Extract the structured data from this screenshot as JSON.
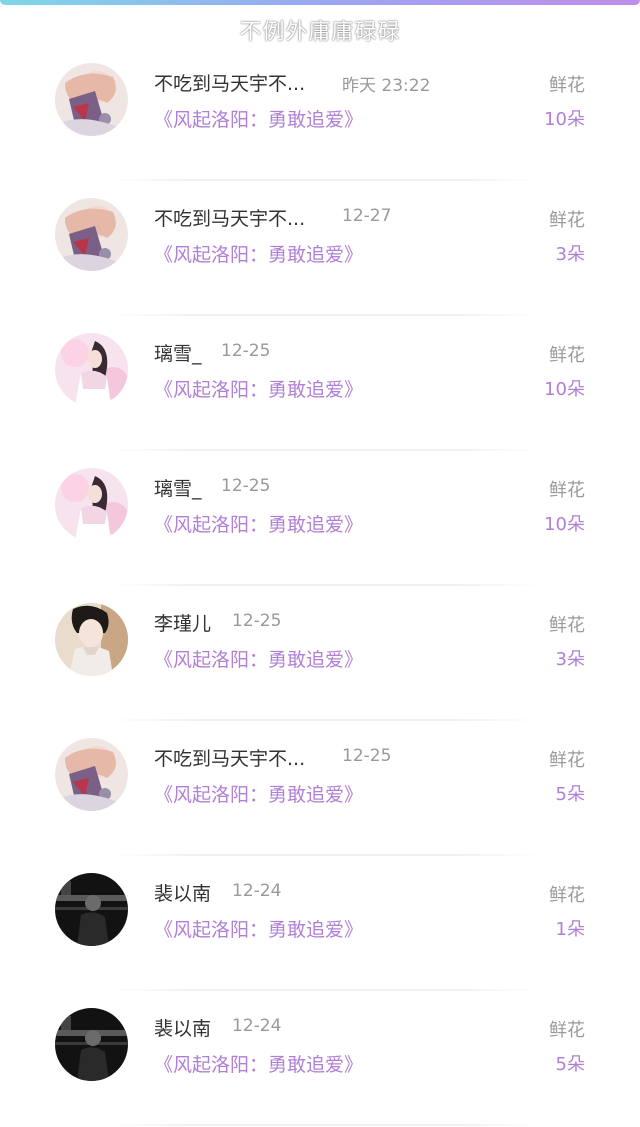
{
  "header": {
    "watermark": "不例外庸庸碌碌"
  },
  "gift_records": [
    {
      "user": "不吃到马天宇不...",
      "time": "昨天 23:22",
      "book": "《风起洛阳：勇敢追爱》",
      "gift_type": "鲜花",
      "count": "10朵",
      "avatar": "anime-girl-avatar"
    },
    {
      "user": "不吃到马天宇不...",
      "time": "12-27",
      "book": "《风起洛阳：勇敢追爱》",
      "gift_type": "鲜花",
      "count": "3朵",
      "avatar": "anime-girl-avatar"
    },
    {
      "user": "璃雪_",
      "time": "12-25",
      "book": "《风起洛阳：勇敢追爱》",
      "gift_type": "鲜花",
      "count": "10朵",
      "avatar": "pink-girl-avatar"
    },
    {
      "user": "璃雪_",
      "time": "12-25",
      "book": "《风起洛阳：勇敢追爱》",
      "gift_type": "鲜花",
      "count": "10朵",
      "avatar": "pink-girl-avatar"
    },
    {
      "user": "李瑾儿",
      "time": "12-25",
      "book": "《风起洛阳：勇敢追爱》",
      "gift_type": "鲜花",
      "count": "3朵",
      "avatar": "portrait-avatar"
    },
    {
      "user": "不吃到马天宇不...",
      "time": "12-25",
      "book": "《风起洛阳：勇敢追爱》",
      "gift_type": "鲜花",
      "count": "5朵",
      "avatar": "anime-girl-avatar"
    },
    {
      "user": "裴以南",
      "time": "12-24",
      "book": "《风起洛阳：勇敢追爱》",
      "gift_type": "鲜花",
      "count": "1朵",
      "avatar": "dark-avatar"
    },
    {
      "user": "裴以南",
      "time": "12-24",
      "book": "《风起洛阳：勇敢追爱》",
      "gift_type": "鲜花",
      "count": "5朵",
      "avatar": "dark-avatar"
    }
  ]
}
